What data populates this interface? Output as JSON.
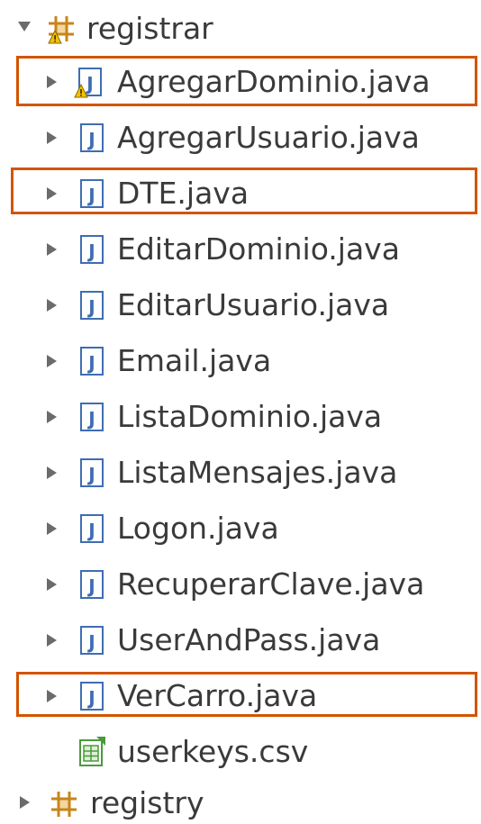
{
  "tree": {
    "package_registrar": {
      "label": "registrar",
      "expanded": true,
      "icon": "package-warning-icon"
    },
    "files": [
      {
        "label": "AgregarDominio.java",
        "icon": "java-file-warning-icon",
        "highlighted": true
      },
      {
        "label": "AgregarUsuario.java",
        "icon": "java-file-icon",
        "highlighted": false
      },
      {
        "label": "DTE.java",
        "icon": "java-file-icon",
        "highlighted": true
      },
      {
        "label": "EditarDominio.java",
        "icon": "java-file-icon",
        "highlighted": false
      },
      {
        "label": "EditarUsuario.java",
        "icon": "java-file-icon",
        "highlighted": false
      },
      {
        "label": "Email.java",
        "icon": "java-file-icon",
        "highlighted": false
      },
      {
        "label": "ListaDominio.java",
        "icon": "java-file-icon",
        "highlighted": false
      },
      {
        "label": "ListaMensajes.java",
        "icon": "java-file-icon",
        "highlighted": false
      },
      {
        "label": "Logon.java",
        "icon": "java-file-icon",
        "highlighted": false
      },
      {
        "label": "RecuperarClave.java",
        "icon": "java-file-icon",
        "highlighted": false
      },
      {
        "label": "UserAndPass.java",
        "icon": "java-file-icon",
        "highlighted": false
      },
      {
        "label": "VerCarro.java",
        "icon": "java-file-icon",
        "highlighted": true
      }
    ],
    "csv_file": {
      "label": "userkeys.csv",
      "icon": "csv-file-icon"
    },
    "package_registry": {
      "label": "registry",
      "expanded": false,
      "icon": "package-icon"
    }
  },
  "colors": {
    "highlight_border": "#d35400",
    "java_icon_blue": "#3f6db3",
    "package_orange": "#c8851b",
    "warning_yellow": "#f2c200",
    "csv_green": "#4a9a3c"
  }
}
